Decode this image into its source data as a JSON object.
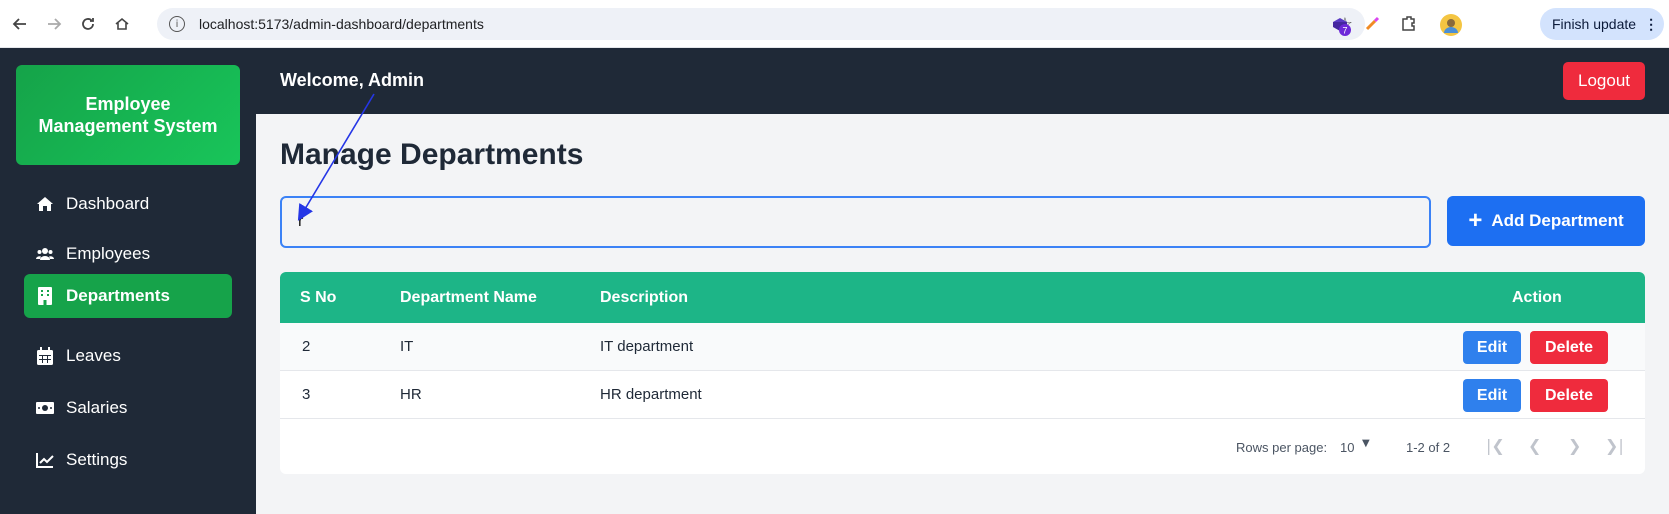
{
  "browser": {
    "url": "localhost:5173/admin-dashboard/departments",
    "finish_update": "Finish update",
    "ext_badge": "7"
  },
  "brand": {
    "title": "Employee Management System"
  },
  "sidebar": {
    "items": [
      {
        "label": "Dashboard",
        "icon": "home-icon"
      },
      {
        "label": "Employees",
        "icon": "users-icon"
      },
      {
        "label": "Departments",
        "icon": "building-icon",
        "active": true
      },
      {
        "label": "Leaves",
        "icon": "calendar-icon"
      },
      {
        "label": "Salaries",
        "icon": "money-icon"
      },
      {
        "label": "Settings",
        "icon": "chart-icon"
      }
    ]
  },
  "header": {
    "welcome": "Welcome, Admin",
    "logout": "Logout"
  },
  "main": {
    "title": "Manage Departments",
    "search_value": "r",
    "add_button": "Add Department"
  },
  "table": {
    "columns": [
      "S No",
      "Department Name",
      "Description",
      "Action"
    ],
    "rows": [
      {
        "sno": "2",
        "name": "IT",
        "description": "IT department",
        "edit": "Edit",
        "delete": "Delete"
      },
      {
        "sno": "3",
        "name": "HR",
        "description": "HR department",
        "edit": "Edit",
        "delete": "Delete"
      }
    ],
    "rows_per_page_label": "Rows per page:",
    "rows_per_page_value": "10",
    "range": "1-2 of 2"
  },
  "colors": {
    "sidebar": "#1f2937",
    "accent_green": "#16a34a",
    "table_header": "#1db587",
    "primary_blue": "#1d6ff2",
    "danger": "#ef2b3d"
  }
}
